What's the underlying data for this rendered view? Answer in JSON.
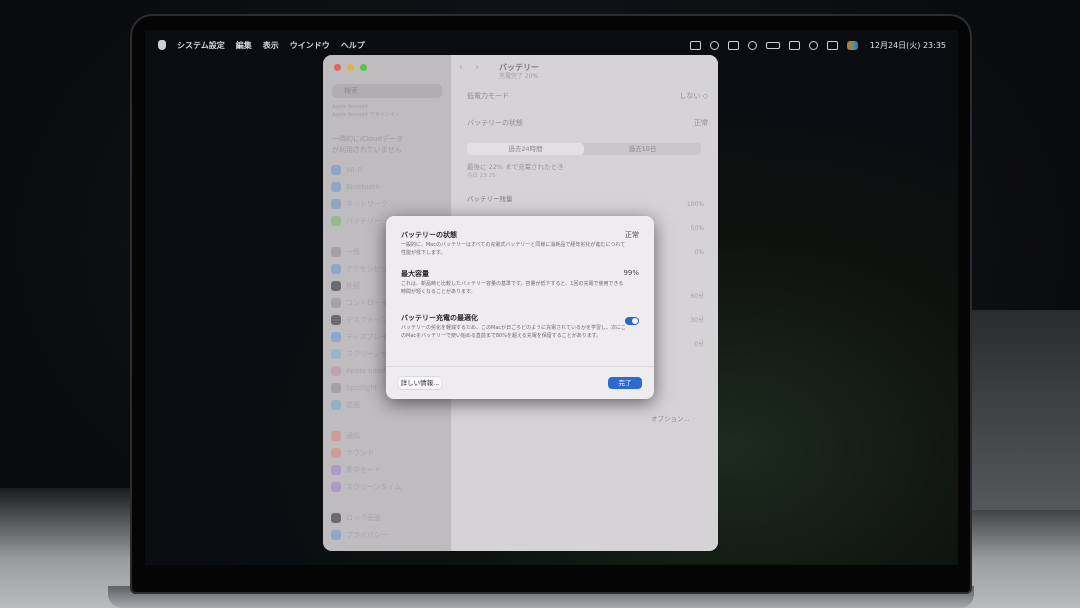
{
  "menubar": {
    "app_name": "システム設定",
    "items": [
      "編集",
      "表示",
      "ウインドウ",
      "ヘルプ"
    ],
    "clock": "12月24日(火) 23:35"
  },
  "settings": {
    "search_placeholder": "検索",
    "account_lines": [
      "Apple Account",
      "Apple Account でサインイン"
    ],
    "icloud_lines": [
      "一時的にiCloudデータ",
      "が利用されていません"
    ],
    "sidebar_items": [
      "Wi-Fi",
      "Bluetooth",
      "ネットワーク",
      "バッテリー",
      "一般",
      "アクセシビリティ",
      "外観",
      "コントロールセンター",
      "デスクトップとDock",
      "ディスプレイ",
      "スクリーンセーバ",
      "Apple Intelligence",
      "Spotlight",
      "壁紙",
      "通知",
      "サウンド",
      "集中モード",
      "スクリーンタイム",
      "ロック画面",
      "プライバシー"
    ],
    "title": "バッテリー",
    "subtitle": "充電完了 20%",
    "low_power_label": "低電力モード",
    "low_power_value": "しない ◇",
    "battery_state_label": "バッテリーの状態",
    "battery_state_value": "正常",
    "tab_24h": "過去24時間",
    "tab_10d": "過去10日",
    "last_charged": "最後に 22% まで充電されたとき",
    "last_charged_time": "今日 23:25",
    "battery_level_label": "バッテリー残量",
    "pct_100": "100%",
    "pct_50": "50%",
    "pct_0": "0%",
    "min_60": "60分",
    "min_30": "30分",
    "min_0": "0分",
    "options_button": "オプション...",
    "help": "?"
  },
  "dialog": {
    "health_title": "バッテリーの状態",
    "health_value": "正常",
    "health_desc": "一般的に、Macのバッテリーはすべての充電式バッテリーと同様に消耗品で経年劣化が進むにつれて性能が低下します。",
    "capacity_title": "最大容量",
    "capacity_value": "99%",
    "capacity_desc": "これは、新品時と比較したバッテリー容量の基準です。容量が低下すると、1回の充電で使用できる時間が短くなることがあります。",
    "opt_title": "バッテリー充電の最適化",
    "opt_desc": "バッテリーの劣化を軽減するため、このMacが日ごろどのように充電されているかを学習し、次にこのMacをバッテリーで使い始める直前まで80%を超える充電を保留することがあります。",
    "opt_enabled": true,
    "more_info_button": "詳しい情報...",
    "done_button": "完了"
  }
}
